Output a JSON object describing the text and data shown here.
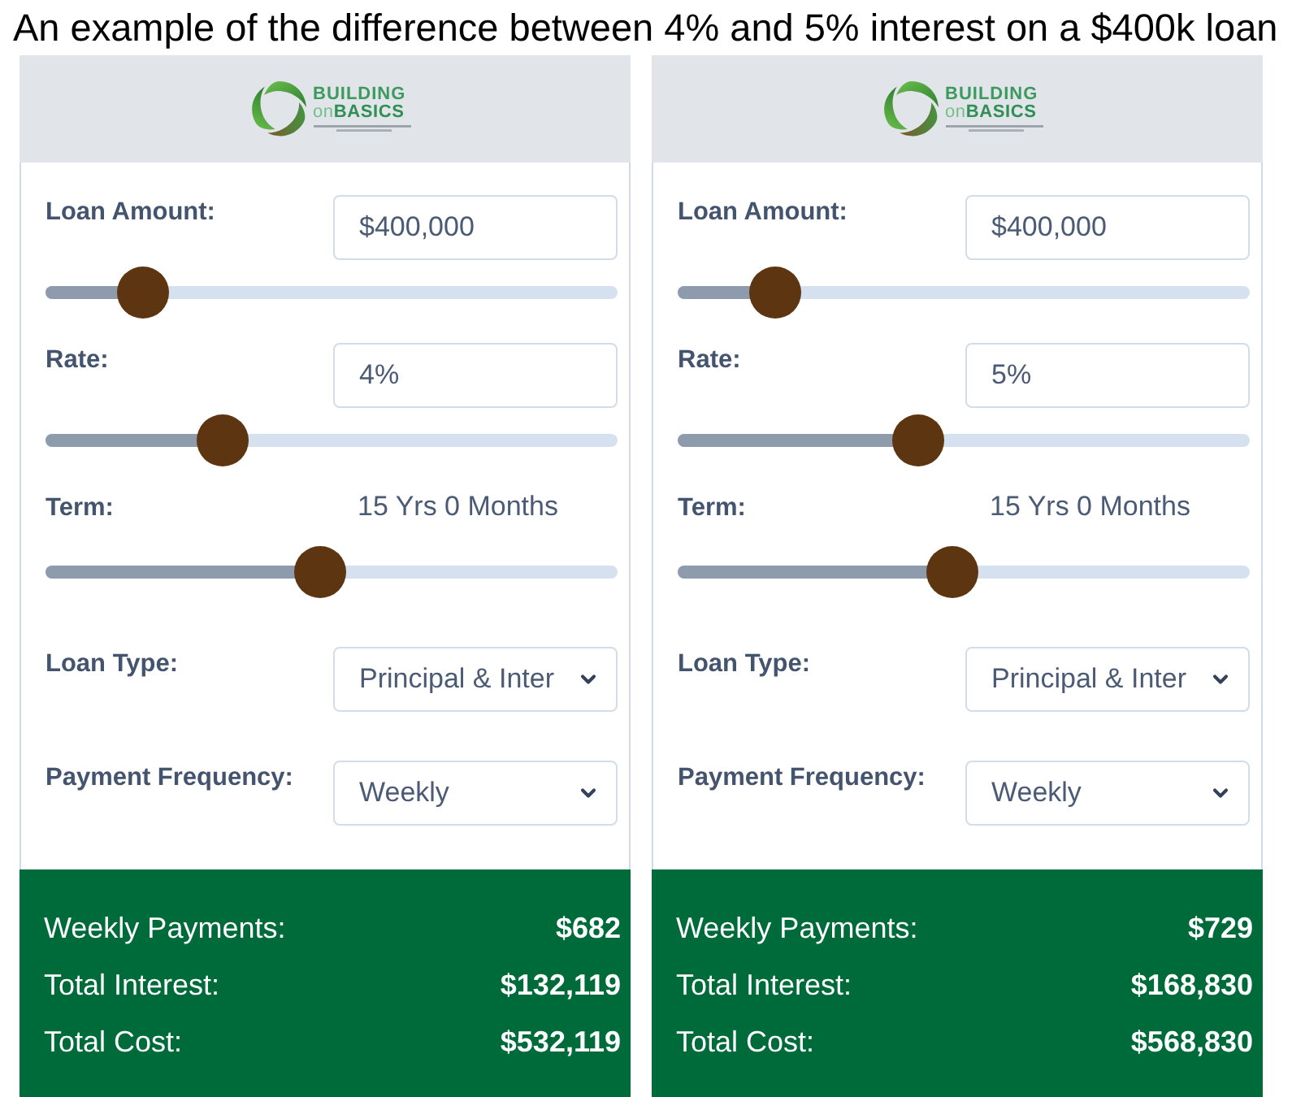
{
  "caption": "An example of the difference between 4% and 5% interest on a $400k loan",
  "calculators": [
    {
      "logo": {
        "line_1": "BUILDING",
        "line_2": "on**BASICS**"
      },
      "fields": [
        {
          "kind": "input",
          "label": "Loan Amount:",
          "value": "$400,000",
          "slider": {
            "level": 0.17
          }
        },
        {
          "kind": "input",
          "label": "Rate:",
          "value": "4%",
          "slider": {
            "level": 0.31
          }
        },
        {
          "kind": "text",
          "label": "Term:",
          "value": "15 Yrs 0 Months",
          "slider": {
            "level": 0.48
          }
        },
        {
          "kind": "select",
          "label": "Loan Type:",
          "value": "Principal & Inter"
        },
        {
          "kind": "select",
          "label": "Payment Frequency:",
          "value": "Weekly"
        }
      ],
      "results": [
        {
          "label": "Weekly Payments:",
          "value": "$682"
        },
        {
          "label": "Total Interest:",
          "value": "$132,119"
        },
        {
          "label": "Total Cost:",
          "value": "$532,119"
        }
      ]
    },
    {
      "logo": {
        "line_1": "BUILDING",
        "line_2": "on**BASICS**"
      },
      "fields": [
        {
          "kind": "input",
          "label": "Loan Amount:",
          "value": "$400,000",
          "slider": {
            "level": 0.17
          }
        },
        {
          "kind": "input",
          "label": "Rate:",
          "value": "5%",
          "slider": {
            "level": 0.42
          }
        },
        {
          "kind": "text",
          "label": "Term:",
          "value": "15 Yrs 0 Months",
          "slider": {
            "level": 0.48
          }
        },
        {
          "kind": "select",
          "label": "Loan Type:",
          "value": "Principal & Inter"
        },
        {
          "kind": "select",
          "label": "Payment Frequency:",
          "value": "Weekly"
        }
      ],
      "results": [
        {
          "label": "Weekly Payments:",
          "value": "$729"
        },
        {
          "label": "Total Interest:",
          "value": "$168,830"
        },
        {
          "label": "Total Cost:",
          "value": "$568,830"
        }
      ]
    }
  ]
}
